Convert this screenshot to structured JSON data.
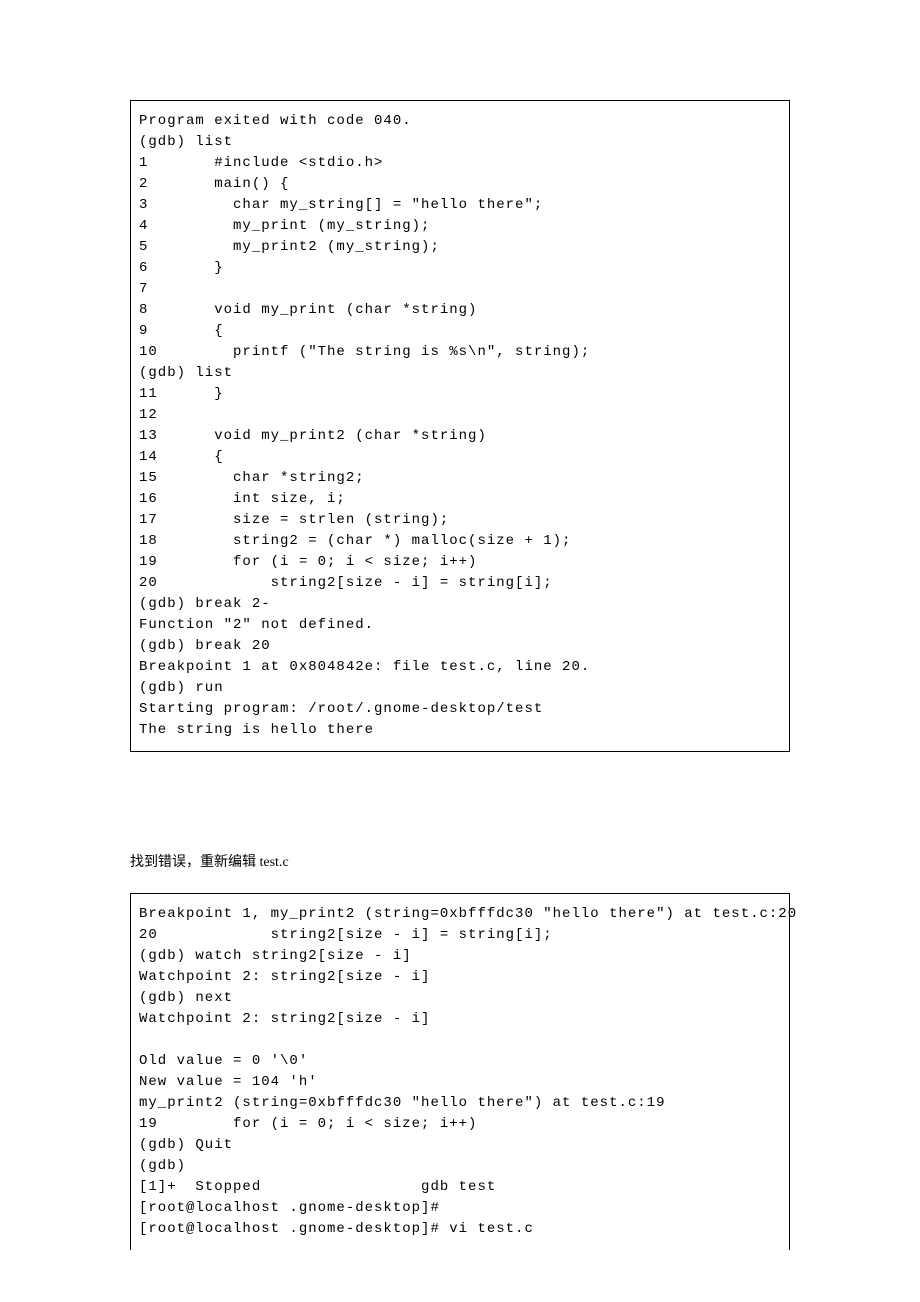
{
  "block1": {
    "line1": "Program exited with code 040.",
    "line2": "(gdb) list",
    "line3": "1       #include <stdio.h>",
    "line4": "2       main() {",
    "line5": "3         char my_string[] = \"hello there\";",
    "line6": "4         my_print (my_string);",
    "line7": "5         my_print2 (my_string);",
    "line8": "6       }",
    "line9": "7",
    "line10": "8       void my_print (char *string)",
    "line11": "9       {",
    "line12": "10        printf (\"The string is %s\\n\", string);",
    "line13": "(gdb) list",
    "line14": "11      }",
    "line15": "12",
    "line16": "13      void my_print2 (char *string)",
    "line17": "14      {",
    "line18": "15        char *string2;",
    "line19": "16        int size, i;",
    "line20": "17        size = strlen (string);",
    "line21": "18        string2 = (char *) malloc(size + 1);",
    "line22": "19        for (i = 0; i < size; i++)",
    "line23": "20            string2[size - i] = string[i];",
    "line24": "(gdb) break 2-",
    "line25": "Function \"2\" not defined.",
    "line26": "(gdb) break 20",
    "line27": "Breakpoint 1 at 0x804842e: file test.c, line 20.",
    "line28": "(gdb) run",
    "line29": "Starting program: /root/.gnome-desktop/test",
    "line30": "The string is hello there"
  },
  "middle_text": "找到错误，重新编辑 test.c",
  "block2": {
    "line1": "Breakpoint 1, my_print2 (string=0xbfffdc30 \"hello there\") at test.c:20",
    "line2": "20            string2[size - i] = string[i];",
    "line3": "(gdb) watch string2[size - i]",
    "line4": "Watchpoint 2: string2[size - i]",
    "line5": "(gdb) next",
    "line6": "Watchpoint 2: string2[size - i]",
    "line7": "",
    "line8": "Old value = 0 '\\0'",
    "line9": "New value = 104 'h'",
    "line10": "my_print2 (string=0xbfffdc30 \"hello there\") at test.c:19",
    "line11": "19        for (i = 0; i < size; i++)",
    "line12": "(gdb) Quit",
    "line13": "(gdb)",
    "line14": "[1]+  Stopped                 gdb test",
    "line15": "[root@localhost .gnome-desktop]#",
    "line16": "[root@localhost .gnome-desktop]# vi test.c"
  }
}
